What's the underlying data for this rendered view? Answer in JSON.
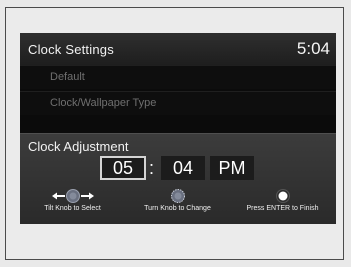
{
  "header": {
    "title": "Clock Settings",
    "time": "5:04"
  },
  "menu": {
    "items": [
      {
        "label": "Default"
      },
      {
        "label": "Clock/Wallpaper Type"
      }
    ]
  },
  "adjust": {
    "title": "Clock Adjustment",
    "hour": "05",
    "separator": ":",
    "minute": "04",
    "ampm": "PM"
  },
  "hints": [
    {
      "label": "Tilt Knob to Select",
      "icon": "tilt-knob-icon"
    },
    {
      "label": "Turn Knob to Change",
      "icon": "turn-knob-icon"
    },
    {
      "label": "Press ENTER to Finish",
      "icon": "enter-button-icon"
    }
  ],
  "colors": {
    "screen_bg": "#0b0b0b",
    "header_bg": "#2a2a2a",
    "panel_bg": "#333333",
    "text": "#f2f2f2",
    "dim_text": "#6f6f6f",
    "highlight_border": "#d4d4d4"
  }
}
